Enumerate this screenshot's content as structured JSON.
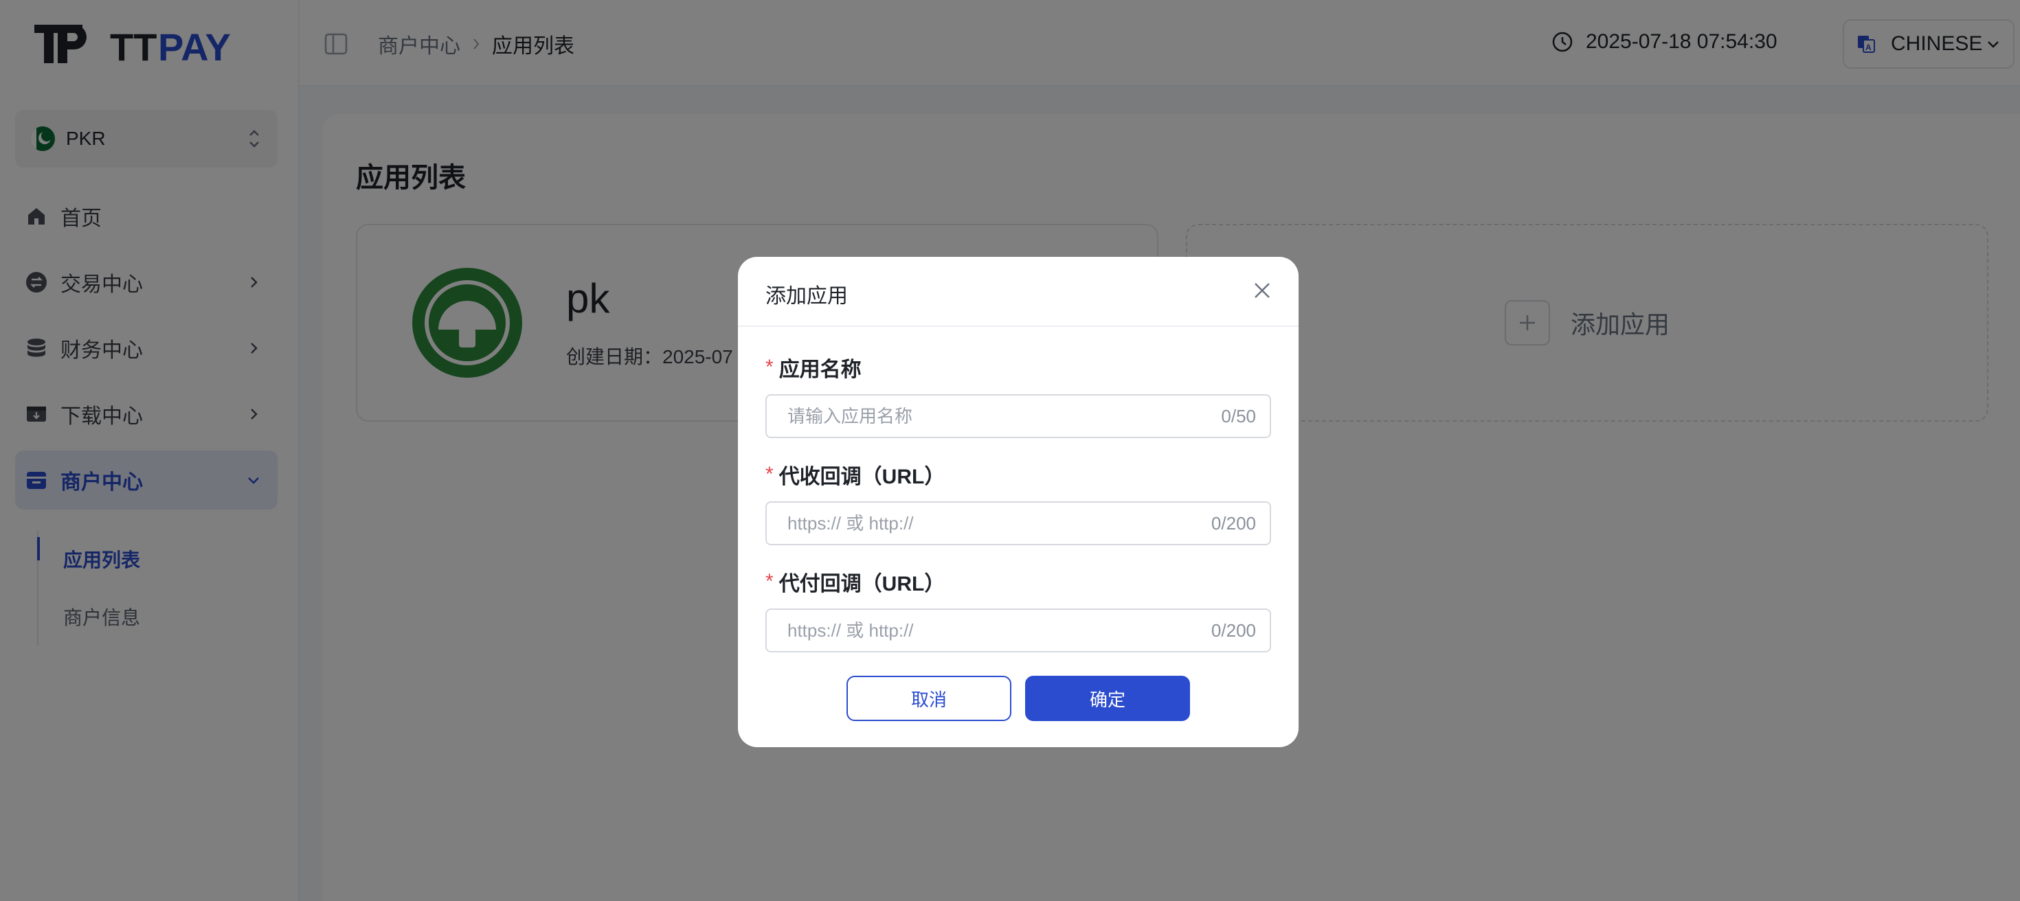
{
  "app": {
    "logo_text": "TTPAY",
    "brand_dark": "#1f2329",
    "brand_blue": "#2b4ccf"
  },
  "sidebar": {
    "currency": {
      "label": "PKR",
      "flag": "pakistan-flag-icon"
    },
    "items": [
      {
        "label": "首页",
        "icon": "home-icon",
        "expandable": false
      },
      {
        "label": "交易中心",
        "icon": "exchange-icon",
        "expandable": true
      },
      {
        "label": "财务中心",
        "icon": "database-icon",
        "expandable": true
      },
      {
        "label": "下载中心",
        "icon": "download-box-icon",
        "expandable": true
      },
      {
        "label": "商户中心",
        "icon": "store-icon",
        "expandable": true,
        "expanded": true,
        "active": true
      }
    ],
    "subitems": [
      {
        "label": "应用列表",
        "active": true
      },
      {
        "label": "商户信息",
        "active": false
      }
    ]
  },
  "header": {
    "breadcrumb": [
      "商户中心",
      "应用列表"
    ],
    "datetime": "2025-07-18 07:54:30",
    "language": "CHINESE"
  },
  "main": {
    "title": "应用列表",
    "apps": [
      {
        "name": "pk",
        "created_label": "创建日期：2025-07"
      }
    ],
    "add_card_label": "添加应用"
  },
  "modal": {
    "title": "添加应用",
    "fields": [
      {
        "label": "应用名称",
        "required": true,
        "value": "",
        "placeholder": "请输入应用名称",
        "count": "0/50"
      },
      {
        "label": "代收回调（URL）",
        "required": true,
        "value": "",
        "placeholder": "https:// 或 http://",
        "count": "0/200"
      },
      {
        "label": "代付回调（URL）",
        "required": true,
        "value": "",
        "placeholder": "https:// 或 http://",
        "count": "0/200"
      }
    ],
    "cancel_label": "取消",
    "confirm_label": "确定"
  }
}
